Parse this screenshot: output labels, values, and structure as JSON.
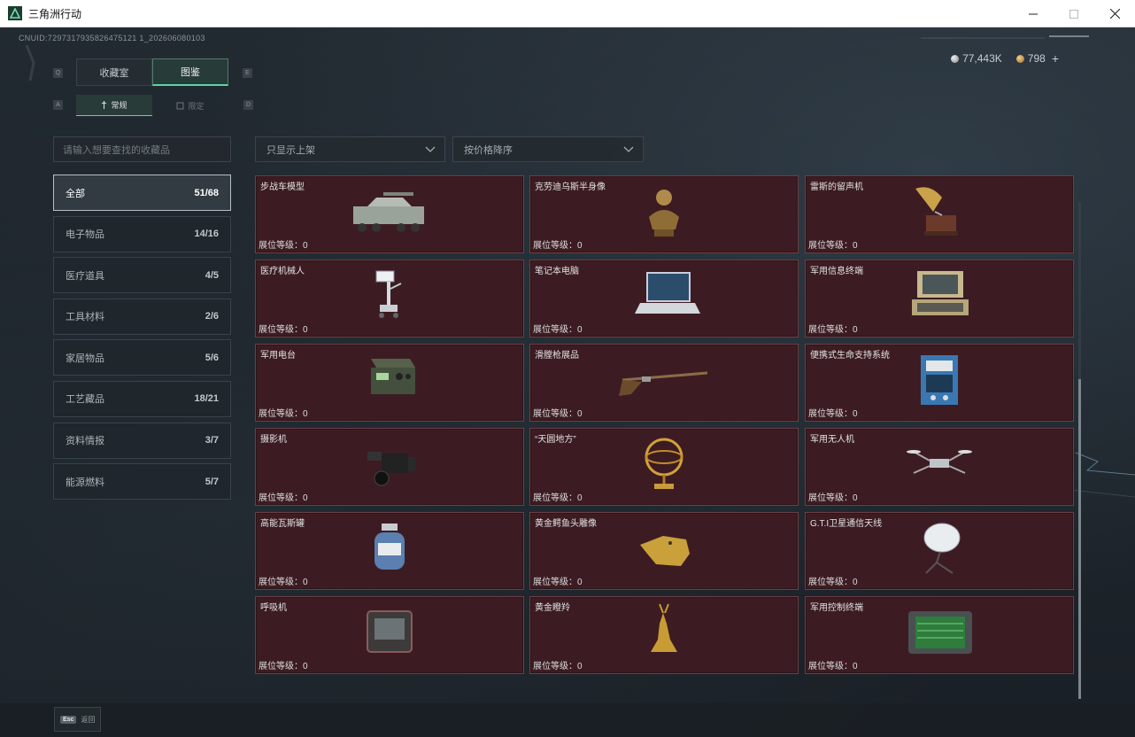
{
  "window": {
    "title": "三角洲行动"
  },
  "header": {
    "uid": "CNUID:7297317935826475121 1_202606080103",
    "currency": [
      {
        "kind": "silver",
        "value": "77,443K"
      },
      {
        "kind": "gold",
        "value": "798"
      }
    ],
    "plus_label": "+"
  },
  "tabs": {
    "primary": [
      {
        "label": "收藏室",
        "active": false,
        "key": "Q"
      },
      {
        "label": "图鉴",
        "active": true,
        "key": "E"
      }
    ],
    "secondary": [
      {
        "label": "常规",
        "active": true,
        "key": "A"
      },
      {
        "label": "限定",
        "active": false,
        "key": "D"
      }
    ]
  },
  "search": {
    "placeholder": "请输入想要查找的收藏品"
  },
  "filters": {
    "shelf_filter": "只显示上架",
    "sort": "按价格降序"
  },
  "categories": [
    {
      "label": "全部",
      "count": "51/68",
      "active": true
    },
    {
      "label": "电子物品",
      "count": "14/16"
    },
    {
      "label": "医疗道具",
      "count": "4/5"
    },
    {
      "label": "工具材料",
      "count": "2/6"
    },
    {
      "label": "家居物品",
      "count": "5/6"
    },
    {
      "label": "工艺藏品",
      "count": "18/21"
    },
    {
      "label": "资料情报",
      "count": "3/7"
    },
    {
      "label": "能源燃料",
      "count": "5/7"
    }
  ],
  "items": [
    {
      "name": "步战车模型",
      "level": "展位等级：0",
      "icon": "ifv-model-icon"
    },
    {
      "name": "克劳迪乌斯半身像",
      "level": "展位等级：0",
      "icon": "bust-icon"
    },
    {
      "name": "雷斯的留声机",
      "level": "展位等级：0",
      "icon": "gramophone-icon"
    },
    {
      "name": "医疗机械人",
      "level": "展位等级：0",
      "icon": "medical-robot-icon"
    },
    {
      "name": "笔记本电脑",
      "level": "展位等级：0",
      "icon": "laptop-icon"
    },
    {
      "name": "军用信息终端",
      "level": "展位等级：0",
      "icon": "military-terminal-icon"
    },
    {
      "name": "军用电台",
      "level": "展位等级：0",
      "icon": "military-radio-icon"
    },
    {
      "name": "滑膛枪展品",
      "level": "展位等级：0",
      "icon": "musket-icon"
    },
    {
      "name": "便携式生命支持系统",
      "level": "展位等级：0",
      "icon": "life-support-icon"
    },
    {
      "name": "摄影机",
      "level": "展位等级：0",
      "icon": "video-camera-icon"
    },
    {
      "name": "“天圆地方”",
      "level": "展位等级：0",
      "icon": "armillary-sphere-icon"
    },
    {
      "name": "军用无人机",
      "level": "展位等级：0",
      "icon": "drone-icon"
    },
    {
      "name": "高能瓦斯罐",
      "level": "展位等级：0",
      "icon": "gas-canister-icon"
    },
    {
      "name": "黄金鳄鱼头雕像",
      "level": "展位等级：0",
      "icon": "gold-crocodile-icon"
    },
    {
      "name": "G.T.I卫星通信天线",
      "level": "展位等级：0",
      "icon": "satellite-dish-icon"
    },
    {
      "name": "呼吸机",
      "level": "展位等级：0",
      "icon": "ventilator-icon"
    },
    {
      "name": "黄金瞪羚",
      "level": "展位等级：0",
      "icon": "gold-gazelle-icon"
    },
    {
      "name": "军用控制终端",
      "level": "展位等级：0",
      "icon": "control-terminal-icon"
    }
  ],
  "footer": {
    "esc_key": "Esc",
    "back_label": "返回"
  }
}
